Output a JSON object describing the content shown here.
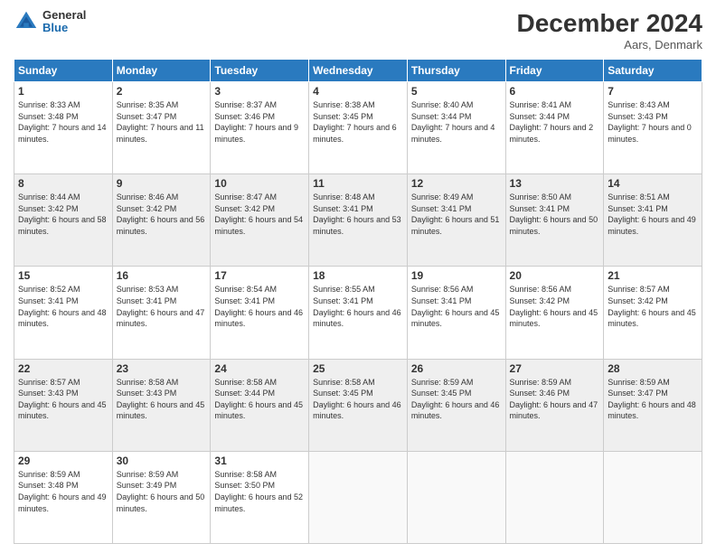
{
  "header": {
    "logo_general": "General",
    "logo_blue": "Blue",
    "month_title": "December 2024",
    "subtitle": "Aars, Denmark"
  },
  "weekdays": [
    "Sunday",
    "Monday",
    "Tuesday",
    "Wednesday",
    "Thursday",
    "Friday",
    "Saturday"
  ],
  "weeks": [
    [
      {
        "day": "1",
        "rise": "Sunrise: 8:33 AM",
        "set": "Sunset: 3:48 PM",
        "daylight": "Daylight: 7 hours and 14 minutes."
      },
      {
        "day": "2",
        "rise": "Sunrise: 8:35 AM",
        "set": "Sunset: 3:47 PM",
        "daylight": "Daylight: 7 hours and 11 minutes."
      },
      {
        "day": "3",
        "rise": "Sunrise: 8:37 AM",
        "set": "Sunset: 3:46 PM",
        "daylight": "Daylight: 7 hours and 9 minutes."
      },
      {
        "day": "4",
        "rise": "Sunrise: 8:38 AM",
        "set": "Sunset: 3:45 PM",
        "daylight": "Daylight: 7 hours and 6 minutes."
      },
      {
        "day": "5",
        "rise": "Sunrise: 8:40 AM",
        "set": "Sunset: 3:44 PM",
        "daylight": "Daylight: 7 hours and 4 minutes."
      },
      {
        "day": "6",
        "rise": "Sunrise: 8:41 AM",
        "set": "Sunset: 3:44 PM",
        "daylight": "Daylight: 7 hours and 2 minutes."
      },
      {
        "day": "7",
        "rise": "Sunrise: 8:43 AM",
        "set": "Sunset: 3:43 PM",
        "daylight": "Daylight: 7 hours and 0 minutes."
      }
    ],
    [
      {
        "day": "8",
        "rise": "Sunrise: 8:44 AM",
        "set": "Sunset: 3:42 PM",
        "daylight": "Daylight: 6 hours and 58 minutes."
      },
      {
        "day": "9",
        "rise": "Sunrise: 8:46 AM",
        "set": "Sunset: 3:42 PM",
        "daylight": "Daylight: 6 hours and 56 minutes."
      },
      {
        "day": "10",
        "rise": "Sunrise: 8:47 AM",
        "set": "Sunset: 3:42 PM",
        "daylight": "Daylight: 6 hours and 54 minutes."
      },
      {
        "day": "11",
        "rise": "Sunrise: 8:48 AM",
        "set": "Sunset: 3:41 PM",
        "daylight": "Daylight: 6 hours and 53 minutes."
      },
      {
        "day": "12",
        "rise": "Sunrise: 8:49 AM",
        "set": "Sunset: 3:41 PM",
        "daylight": "Daylight: 6 hours and 51 minutes."
      },
      {
        "day": "13",
        "rise": "Sunrise: 8:50 AM",
        "set": "Sunset: 3:41 PM",
        "daylight": "Daylight: 6 hours and 50 minutes."
      },
      {
        "day": "14",
        "rise": "Sunrise: 8:51 AM",
        "set": "Sunset: 3:41 PM",
        "daylight": "Daylight: 6 hours and 49 minutes."
      }
    ],
    [
      {
        "day": "15",
        "rise": "Sunrise: 8:52 AM",
        "set": "Sunset: 3:41 PM",
        "daylight": "Daylight: 6 hours and 48 minutes."
      },
      {
        "day": "16",
        "rise": "Sunrise: 8:53 AM",
        "set": "Sunset: 3:41 PM",
        "daylight": "Daylight: 6 hours and 47 minutes."
      },
      {
        "day": "17",
        "rise": "Sunrise: 8:54 AM",
        "set": "Sunset: 3:41 PM",
        "daylight": "Daylight: 6 hours and 46 minutes."
      },
      {
        "day": "18",
        "rise": "Sunrise: 8:55 AM",
        "set": "Sunset: 3:41 PM",
        "daylight": "Daylight: 6 hours and 46 minutes."
      },
      {
        "day": "19",
        "rise": "Sunrise: 8:56 AM",
        "set": "Sunset: 3:41 PM",
        "daylight": "Daylight: 6 hours and 45 minutes."
      },
      {
        "day": "20",
        "rise": "Sunrise: 8:56 AM",
        "set": "Sunset: 3:42 PM",
        "daylight": "Daylight: 6 hours and 45 minutes."
      },
      {
        "day": "21",
        "rise": "Sunrise: 8:57 AM",
        "set": "Sunset: 3:42 PM",
        "daylight": "Daylight: 6 hours and 45 minutes."
      }
    ],
    [
      {
        "day": "22",
        "rise": "Sunrise: 8:57 AM",
        "set": "Sunset: 3:43 PM",
        "daylight": "Daylight: 6 hours and 45 minutes."
      },
      {
        "day": "23",
        "rise": "Sunrise: 8:58 AM",
        "set": "Sunset: 3:43 PM",
        "daylight": "Daylight: 6 hours and 45 minutes."
      },
      {
        "day": "24",
        "rise": "Sunrise: 8:58 AM",
        "set": "Sunset: 3:44 PM",
        "daylight": "Daylight: 6 hours and 45 minutes."
      },
      {
        "day": "25",
        "rise": "Sunrise: 8:58 AM",
        "set": "Sunset: 3:45 PM",
        "daylight": "Daylight: 6 hours and 46 minutes."
      },
      {
        "day": "26",
        "rise": "Sunrise: 8:59 AM",
        "set": "Sunset: 3:45 PM",
        "daylight": "Daylight: 6 hours and 46 minutes."
      },
      {
        "day": "27",
        "rise": "Sunrise: 8:59 AM",
        "set": "Sunset: 3:46 PM",
        "daylight": "Daylight: 6 hours and 47 minutes."
      },
      {
        "day": "28",
        "rise": "Sunrise: 8:59 AM",
        "set": "Sunset: 3:47 PM",
        "daylight": "Daylight: 6 hours and 48 minutes."
      }
    ],
    [
      {
        "day": "29",
        "rise": "Sunrise: 8:59 AM",
        "set": "Sunset: 3:48 PM",
        "daylight": "Daylight: 6 hours and 49 minutes."
      },
      {
        "day": "30",
        "rise": "Sunrise: 8:59 AM",
        "set": "Sunset: 3:49 PM",
        "daylight": "Daylight: 6 hours and 50 minutes."
      },
      {
        "day": "31",
        "rise": "Sunrise: 8:58 AM",
        "set": "Sunset: 3:50 PM",
        "daylight": "Daylight: 6 hours and 52 minutes."
      },
      null,
      null,
      null,
      null
    ]
  ]
}
